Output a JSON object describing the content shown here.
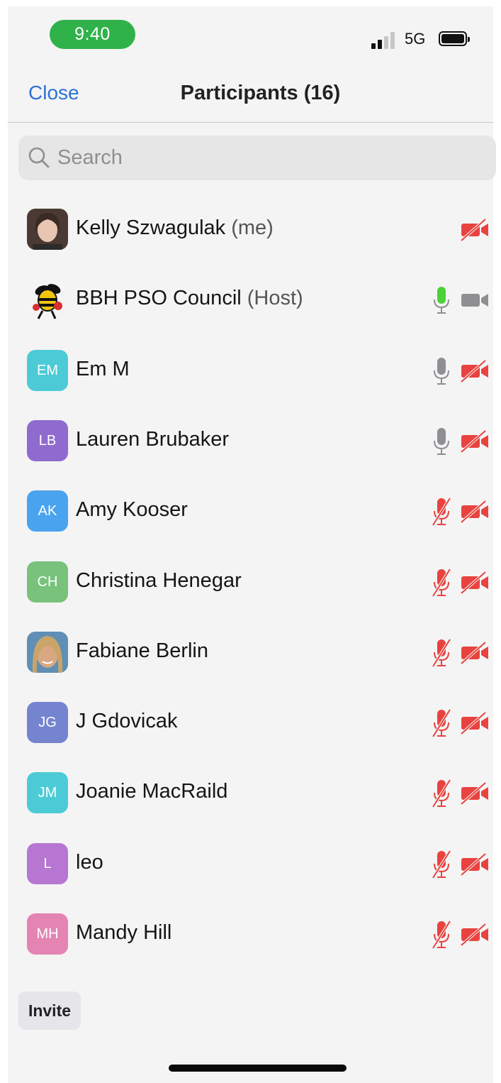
{
  "status_bar": {
    "time": "9:40",
    "network": "5G"
  },
  "header": {
    "close_label": "Close",
    "title": "Participants (16)"
  },
  "search": {
    "placeholder": "Search",
    "icon": "search-icon"
  },
  "participants": [
    {
      "name": "Kelly Szwagulak",
      "role": "(me)",
      "avatar_type": "photo",
      "mic": "none",
      "video": "off"
    },
    {
      "name": "BBH PSO Council",
      "role": "(Host)",
      "avatar_type": "logo",
      "mic": "on-active",
      "video": "on"
    },
    {
      "name": "Em M",
      "role": "",
      "initials": "EM",
      "avatar_color": "#4ccbd6",
      "mic": "on",
      "video": "off"
    },
    {
      "name": "Lauren Brubaker",
      "role": "",
      "initials": "LB",
      "avatar_color": "#8f6bcf",
      "mic": "on",
      "video": "off"
    },
    {
      "name": "Amy Kooser",
      "role": "",
      "initials": "AK",
      "avatar_color": "#4aa3ee",
      "mic": "muted",
      "video": "off"
    },
    {
      "name": "Christina Henegar",
      "role": "",
      "initials": "CH",
      "avatar_color": "#78c27c",
      "mic": "muted",
      "video": "off"
    },
    {
      "name": "Fabiane Berlin",
      "role": "",
      "avatar_type": "photo",
      "mic": "muted",
      "video": "off"
    },
    {
      "name": "J Gdovicak",
      "role": "",
      "initials": "JG",
      "avatar_color": "#7584cf",
      "mic": "muted",
      "video": "off"
    },
    {
      "name": "Joanie MacRaild",
      "role": "",
      "initials": "JM",
      "avatar_color": "#4ccbd6",
      "mic": "muted",
      "video": "off"
    },
    {
      "name": "leo",
      "role": "",
      "initials": "L",
      "avatar_color": "#b776d1",
      "mic": "muted",
      "video": "off"
    },
    {
      "name": "Mandy Hill",
      "role": "",
      "initials": "MH",
      "avatar_color": "#e384b3",
      "mic": "muted",
      "video": "off"
    }
  ],
  "footer": {
    "invite_label": "Invite"
  },
  "colors": {
    "accent": "#2e72d2",
    "muted_red": "#e8433f",
    "active_green": "#4cd137",
    "neutral_gray": "#8e8e93"
  }
}
